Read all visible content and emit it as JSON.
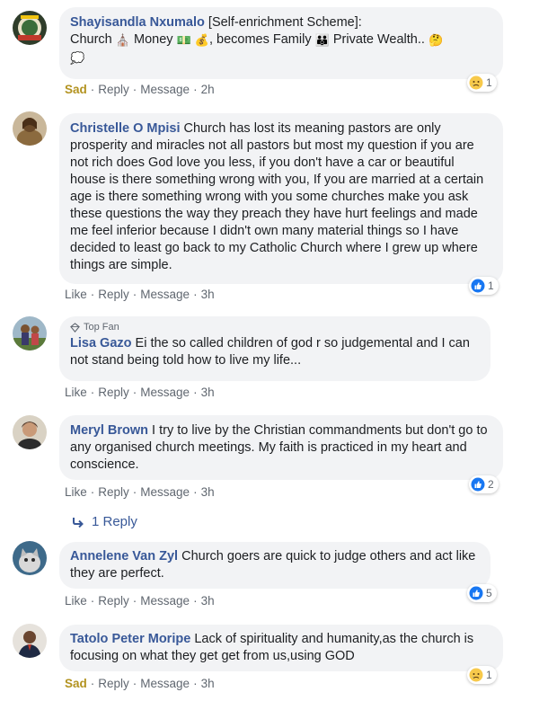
{
  "comments": [
    {
      "author": "Shayisandla Nxumalo",
      "text_parts": [
        "[Self-enrichment Scheme]:",
        "Church",
        "Money",
        ", becomes Family",
        "Private Wealth.."
      ],
      "emojis": {
        "church": "⛪",
        "money": "💵",
        "bag": "💰",
        "family": "👪",
        "thinking": "🤔",
        "speech": "💭"
      },
      "reaction_label": "Sad",
      "reply": "Reply",
      "message": "Message",
      "time": "2h",
      "reaction_count": "1",
      "reaction_type": "sad"
    },
    {
      "author": "Christelle O Mpisi",
      "text": "Church has lost its meaning pastors are only prosperity and miracles not all pastors but most my question if you are not rich does God love you less, if you don't have a car or beautiful house is there something wrong with you, If you are married at a certain age is there something wrong with you some churches make you ask these questions the way they preach they have hurt feelings and made me feel inferior because I didn't own many material things so I have decided to least go back to my Catholic Church where I grew up where things are simple.",
      "like": "Like",
      "reply": "Reply",
      "message": "Message",
      "time": "3h",
      "reaction_count": "1",
      "reaction_type": "like"
    },
    {
      "badge": "Top Fan",
      "author": "Lisa Gazo",
      "text": "Ei the so called children of god r so judgemental and I can not stand being told how to live my life...",
      "like": "Like",
      "reply": "Reply",
      "message": "Message",
      "time": "3h"
    },
    {
      "author": "Meryl Brown",
      "text": "I try to live by the Christian commandments but don't go to any organised church meetings. My faith is practiced in my heart and conscience.",
      "like": "Like",
      "reply": "Reply",
      "message": "Message",
      "time": "3h",
      "reaction_count": "2",
      "reaction_type": "like",
      "replies_link": "1 Reply"
    },
    {
      "author": "Annelene Van Zyl",
      "text": "Church goers are quick to judge others and act like they are perfect.",
      "like": "Like",
      "reply": "Reply",
      "message": "Message",
      "time": "3h",
      "reaction_count": "5",
      "reaction_type": "like"
    },
    {
      "author": "Tatolo Peter Moripe",
      "text": "Lack of spirituality and humanity,as the church is focusing on what they get get from us,using GOD",
      "reaction_label": "Sad",
      "reply": "Reply",
      "message": "Message",
      "time": "3h",
      "reaction_count": "1",
      "reaction_type": "sad"
    }
  ],
  "colors": {
    "author": "#385898",
    "bubble": "#f2f3f5",
    "meta": "#606770",
    "sad": "#b39320",
    "like_blue": "#1877f2"
  }
}
